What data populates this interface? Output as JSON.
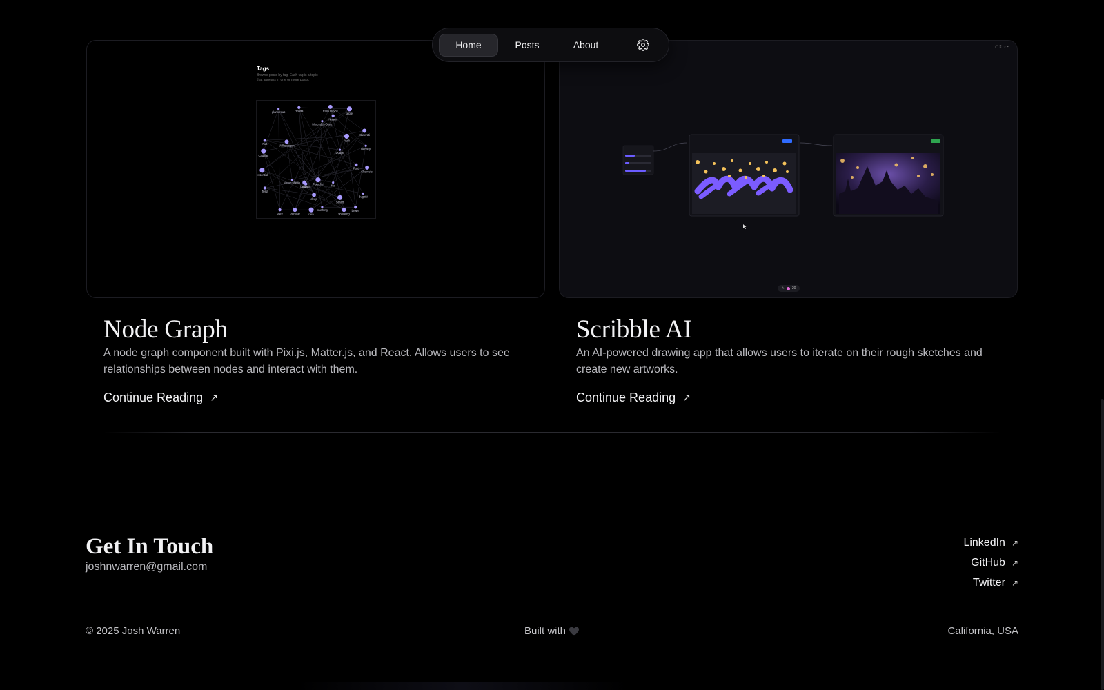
{
  "nav": {
    "home_label": "Home",
    "posts_label": "Posts",
    "about_label": "About",
    "settings_icon": "gear-icon"
  },
  "posts": [
    {
      "title": "Node Graph",
      "description": "A node graph component built with Pixi.js, Matter.js, and React. Allows users to see relationships between nodes and interact with them.",
      "link_label": "Continue Reading",
      "link_icon": "arrow-up-right-icon",
      "preview": {
        "heading": "Tags",
        "subtext": "Browse posts by tag. Each tag is a topic that appears in one or more posts.",
        "node_labels": [
          "glamorous",
          "Honda",
          "Rolls Royce",
          "secret",
          "Mercedes-Benz",
          "Nissan",
          "Maserati",
          "Audi",
          "Bentley",
          "Fiat",
          "Volkswagen",
          "Cadillac",
          "Dodge",
          "Ford",
          "Chevrolet",
          "essential",
          "Aston Martin",
          "Ferrari",
          "boring",
          "Porsche",
          "Kia",
          "Tesla",
          "deep",
          "Smart",
          "Bugatti",
          "pure",
          "Peculiar",
          "rare",
          "crushing",
          "brown",
          "shocking"
        ]
      }
    },
    {
      "title": "Scribble AI",
      "description": "An AI-powered drawing app that allows users to iterate on their rough sketches and create new artworks.",
      "link_label": "Continue Reading",
      "link_icon": "arrow-up-right-icon",
      "preview": {
        "counter": "20"
      }
    }
  ],
  "contact": {
    "title": "Get In Touch",
    "email": "joshnwarren@gmail.com"
  },
  "socials": [
    {
      "label": "LinkedIn",
      "icon": "arrow-up-right-icon"
    },
    {
      "label": "GitHub",
      "icon": "arrow-up-right-icon"
    },
    {
      "label": "Twitter",
      "icon": "arrow-up-right-icon"
    }
  ],
  "footer": {
    "copyright": "© 2025 Josh Warren",
    "built_with": "Built with",
    "heart_icon": "heart-icon",
    "location": "California, USA"
  },
  "colors": {
    "background": "#000000",
    "node_purple": "#a99bff",
    "scribble_purple": "#7b5cff",
    "scribble_yellow": "#f4c25a"
  }
}
